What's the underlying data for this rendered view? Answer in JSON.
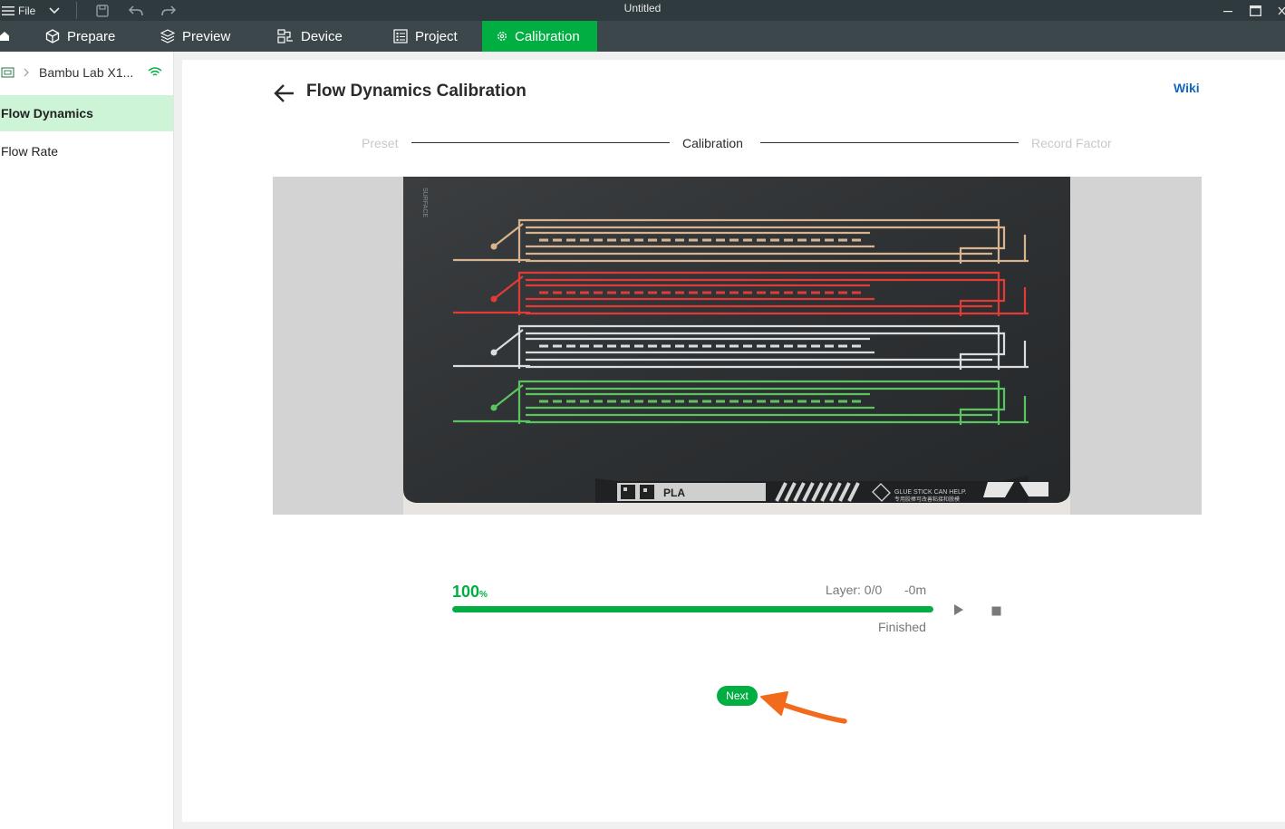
{
  "titlebar": {
    "file_label": "File",
    "window_title": "Untitled"
  },
  "nav": {
    "tabs": [
      {
        "label": "Prepare",
        "icon": "cube-icon"
      },
      {
        "label": "Preview",
        "icon": "layers-icon"
      },
      {
        "label": "Device",
        "icon": "device-icon"
      },
      {
        "label": "Project",
        "icon": "project-icon"
      },
      {
        "label": "Calibration",
        "icon": "gear-icon",
        "active": true
      }
    ]
  },
  "sidebar": {
    "printer_name": "Bambu Lab X1...",
    "items": [
      {
        "label": "Flow Dynamics",
        "active": true
      },
      {
        "label": "Flow Rate",
        "active": false
      }
    ]
  },
  "page": {
    "title": "Flow Dynamics Calibration",
    "wiki_label": "Wiki"
  },
  "steps": [
    {
      "label": "Preset",
      "state": "done"
    },
    {
      "label": "Calibration",
      "state": "current"
    },
    {
      "label": "Record Factor",
      "state": "pending"
    }
  ],
  "plate": {
    "brand_text": "PLA",
    "warning_text": "GLUE STICK CAN HELP.",
    "warning_text_cn": "专用胶棒可改善粘接和脱模",
    "side_text": "SURFACE"
  },
  "progress": {
    "percent_value": "100",
    "percent_unit": "%",
    "fraction": 1.0,
    "layer": "Layer: 0/0",
    "eta": "-0m",
    "status": "Finished"
  },
  "actions": {
    "next_label": "Next"
  },
  "colors": {
    "accent": "#00ae42",
    "nav_bg": "#3c474c",
    "titlebar_bg": "#2f3a3e",
    "sidebar_active": "#cef4d7",
    "link": "#1566c0",
    "annotation_arrow": "#f26b1d"
  }
}
